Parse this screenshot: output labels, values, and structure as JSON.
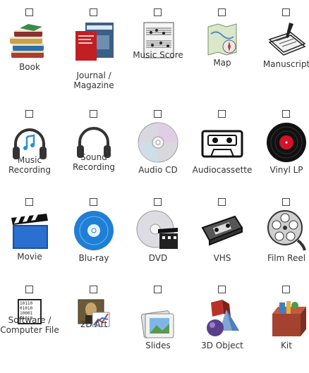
{
  "items": [
    {
      "label": "Book",
      "icon": "book-stack-icon"
    },
    {
      "label": "Journal / Magazine",
      "icon": "journal-icon"
    },
    {
      "label": "Music Score",
      "icon": "music-score-icon"
    },
    {
      "label": "Map",
      "icon": "map-icon"
    },
    {
      "label": "Manuscript",
      "icon": "manuscript-icon"
    },
    {
      "label": "Music Recording",
      "icon": "headphones-music-icon"
    },
    {
      "label": "Sound Recording",
      "icon": "headphones-icon"
    },
    {
      "label": "Audio CD",
      "icon": "cd-icon"
    },
    {
      "label": "Audiocassette",
      "icon": "cassette-icon"
    },
    {
      "label": "Vinyl LP",
      "icon": "vinyl-icon"
    },
    {
      "label": "Movie",
      "icon": "clapperboard-icon"
    },
    {
      "label": "Blu-ray",
      "icon": "bluray-icon"
    },
    {
      "label": "DVD",
      "icon": "dvd-icon"
    },
    {
      "label": "VHS",
      "icon": "vhs-icon"
    },
    {
      "label": "Film Reel",
      "icon": "film-reel-icon"
    },
    {
      "label": "Software / Computer File",
      "icon": "binary-file-icon"
    },
    {
      "label": "2D Art",
      "icon": "art-chart-icon"
    },
    {
      "label": "Slides",
      "icon": "slides-icon"
    },
    {
      "label": "3D Object",
      "icon": "3d-shapes-icon"
    },
    {
      "label": "Kit",
      "icon": "kit-box-icon"
    }
  ]
}
